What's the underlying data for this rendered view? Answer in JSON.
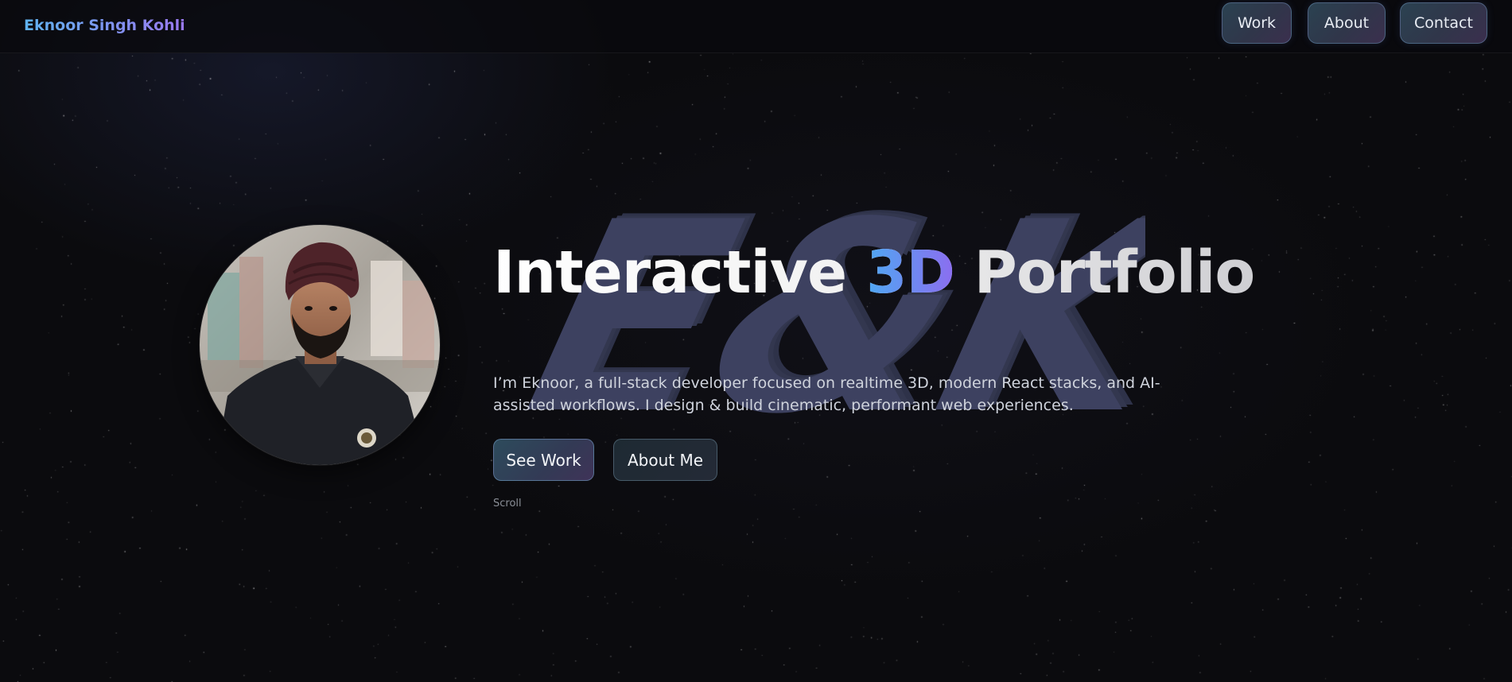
{
  "header": {
    "brand": "Eknoor Singh Kohli",
    "nav": {
      "work": "Work",
      "about": "About",
      "contact": "Contact"
    }
  },
  "hero": {
    "title_before": "Interactive ",
    "title_accent": "3D",
    "title_after": " Portfolio",
    "monogram": "E&K",
    "description": "I’m Eknoor, a full-stack developer focused on realtime 3D, modern React stacks, and AI-assisted workflows. I design & build cinematic, performant web experiences.",
    "cta_primary": "See Work",
    "cta_secondary": "About Me",
    "scroll_hint": "Scroll"
  },
  "colors": {
    "background": "#0b0b0e",
    "brand_gradient": [
      "#5fb3f0",
      "#9a78f0"
    ],
    "accent_gradient": [
      "#4ea8f2",
      "#8c6df0"
    ],
    "monogram": "#3d4160"
  }
}
